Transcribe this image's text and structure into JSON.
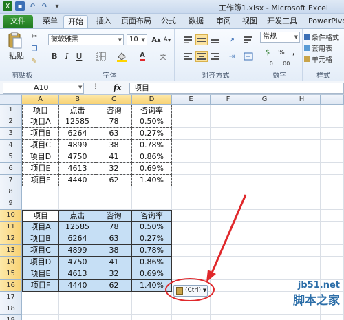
{
  "window": {
    "title": "工作簿1.xlsx - Microsoft Excel"
  },
  "tabs": [
    "文件",
    "菜单",
    "开始",
    "插入",
    "页面布局",
    "公式",
    "数据",
    "审阅",
    "视图",
    "开发工具",
    "PowerPivot"
  ],
  "ribbon": {
    "clipboard": {
      "paste_label": "粘贴",
      "group_label": "剪贴板"
    },
    "font": {
      "font_name": "微软雅黑",
      "font_size": "10",
      "group_label": "字体"
    },
    "alignment": {
      "group_label": "对齐方式"
    },
    "number": {
      "format": "常规",
      "group_label": "数字"
    },
    "styles": {
      "items": [
        "条件格式",
        "套用表",
        "单元格"
      ],
      "group_label": "样式"
    }
  },
  "formula_bar": {
    "name_box": "A10",
    "fx": "fx",
    "value": "项目"
  },
  "columns": [
    "A",
    "B",
    "C",
    "D",
    "E",
    "F",
    "G",
    "H",
    "I"
  ],
  "rows": [
    "1",
    "2",
    "3",
    "4",
    "5",
    "6",
    "7",
    "8",
    "9",
    "10",
    "11",
    "12",
    "13",
    "14",
    "15",
    "16",
    "17",
    "18",
    "19"
  ],
  "table1": {
    "headers": [
      "项目",
      "点击",
      "咨询",
      "咨询率"
    ],
    "rows": [
      [
        "项目A",
        "12585",
        "78",
        "0.50%"
      ],
      [
        "项目B",
        "6264",
        "63",
        "0.27%"
      ],
      [
        "项目C",
        "4899",
        "38",
        "0.78%"
      ],
      [
        "项目D",
        "4750",
        "41",
        "0.86%"
      ],
      [
        "项目E",
        "4613",
        "32",
        "0.69%"
      ],
      [
        "项目F",
        "4440",
        "62",
        "1.40%"
      ]
    ]
  },
  "table2": {
    "headers": [
      "项目",
      "点击",
      "咨询",
      "咨询率"
    ],
    "rows": [
      [
        "项目A",
        "12585",
        "78",
        "0.50%"
      ],
      [
        "项目B",
        "6264",
        "63",
        "0.27%"
      ],
      [
        "项目C",
        "4899",
        "38",
        "0.78%"
      ],
      [
        "项目D",
        "4750",
        "41",
        "0.86%"
      ],
      [
        "项目E",
        "4613",
        "32",
        "0.69%"
      ],
      [
        "项目F",
        "4440",
        "62",
        "1.40%"
      ]
    ]
  },
  "paste_options": {
    "label": "(Ctrl)"
  },
  "watermark": {
    "url": "jb51.net",
    "text": "脚本之家"
  },
  "colors": {
    "file_tab": "#1f7a20",
    "selection": "#c6dff5",
    "annotation": "#e0282b"
  }
}
